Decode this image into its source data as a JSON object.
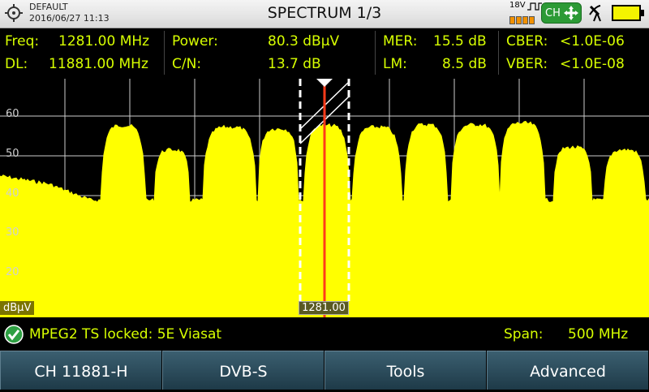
{
  "header": {
    "profile": "DEFAULT",
    "datetime": "2016/06/27 11:13",
    "title": "SPECTRUM 1/3",
    "lnb_voltage": "18V",
    "ch_button_label": "CH",
    "battery_color": "#f4f400"
  },
  "measurements": {
    "freq": {
      "label": "Freq:",
      "value": "1281.00 MHz"
    },
    "dl": {
      "label": "DL:",
      "value": "11881.00 MHz"
    },
    "power": {
      "label": "Power:",
      "value": "80.3 dBµV"
    },
    "cn": {
      "label": "C/N:",
      "value": "13.7 dB"
    },
    "mer": {
      "label": "MER:",
      "value": "15.5 dB"
    },
    "lm": {
      "label": "LM:",
      "value": "8.5 dB"
    },
    "cber": {
      "label": "CBER:",
      "value": "<1.0E-06"
    },
    "vber": {
      "label": "VBER:",
      "value": "<1.0E-08"
    }
  },
  "spectrum": {
    "y_ticks": [
      "60",
      "50",
      "40",
      "30",
      "20"
    ],
    "unit": "dBµV",
    "marker_freq": "1281.00",
    "trace_color": "#ffff00",
    "marker_color": "#ff3b1a"
  },
  "status": {
    "lock_text": "MPEG2 TS locked: 5E Viasat",
    "span_label": "Span:",
    "span_value": "500 MHz"
  },
  "softkeys": [
    {
      "label": "CH 11881-H"
    },
    {
      "label": "DVB-S"
    },
    {
      "label": "Tools"
    },
    {
      "label": "Advanced"
    }
  ]
}
